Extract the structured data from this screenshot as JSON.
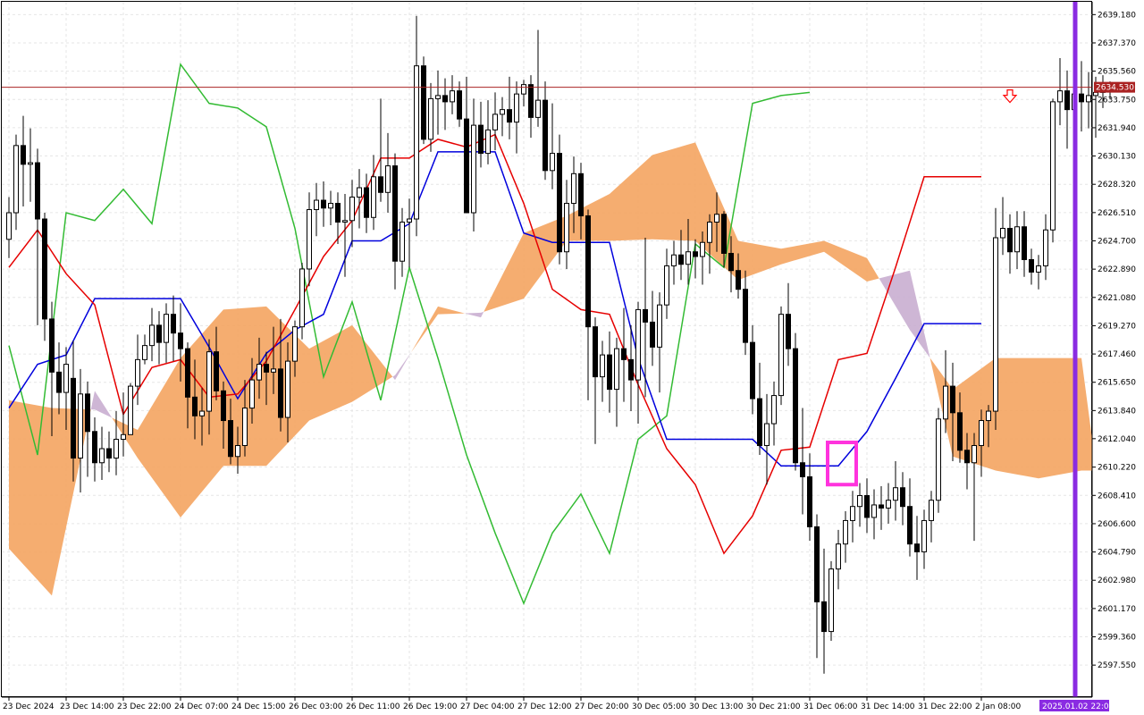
{
  "chart_data": {
    "type": "candlestick",
    "title": "",
    "ylim": [
      2595.5,
      2640.0
    ],
    "grid": true,
    "current_price": "2634.530",
    "current_price_value": 2634.53,
    "cursor_time": "2025.01.02 22:00",
    "y_ticks": [
      "2639.180",
      "2637.370",
      "2635.560",
      "2633.750",
      "2631.940",
      "2630.130",
      "2628.320",
      "2626.510",
      "2624.700",
      "2622.890",
      "2621.080",
      "2619.270",
      "2617.460",
      "2615.650",
      "2613.840",
      "2612.040",
      "2610.220",
      "2608.410",
      "2606.600",
      "2604.790",
      "2602.980",
      "2601.170",
      "2599.360",
      "2597.550"
    ],
    "y_tick_values": [
      2639.18,
      2637.37,
      2635.56,
      2633.75,
      2631.94,
      2630.13,
      2628.32,
      2626.51,
      2624.7,
      2622.89,
      2621.08,
      2619.27,
      2617.46,
      2615.65,
      2613.84,
      2612.04,
      2610.22,
      2608.41,
      2606.6,
      2604.79,
      2602.98,
      2601.17,
      2599.36,
      2597.55
    ],
    "x_ticks": [
      "23 Dec 2024",
      "23 Dec 14:00",
      "23 Dec 22:00",
      "24 Dec 07:00",
      "24 Dec 15:00",
      "26 Dec 03:00",
      "26 Dec 11:00",
      "26 Dec 19:00",
      "27 Dec 04:00",
      "27 Dec 12:00",
      "27 Dec 20:00",
      "30 Dec 05:00",
      "30 Dec 13:00",
      "30 Dec 21:00",
      "31 Dec 06:00",
      "31 Dec 14:00",
      "31 Dec 22:00",
      "2 Jan 08:00"
    ],
    "x_tick_index": [
      0,
      8,
      16,
      24,
      32,
      40,
      48,
      56,
      64,
      72,
      80,
      88,
      96,
      104,
      112,
      120,
      128,
      136
    ],
    "bar_count": 138,
    "colors": {
      "bull": "#000000",
      "bear": "#000000",
      "tenkan": "#e60000",
      "kijun": "#0000dd",
      "chikou": "#33bb33",
      "cloud_up": "#f4a460",
      "cloud_down": "#c9aed0",
      "price_line": "#aa2222",
      "cursor_line": "#8a2be2",
      "highlight": "#ff33dd",
      "arrow": "#ff0000",
      "grid": "#e6e6e6"
    },
    "candles": [
      [
        2624.8,
        2627.5,
        2623.6,
        2626.5
      ],
      [
        2626.5,
        2631.5,
        2625.4,
        2630.8
      ],
      [
        2630.8,
        2632.7,
        2626.9,
        2629.6
      ],
      [
        2629.6,
        2631.9,
        2627.2,
        2629.7
      ],
      [
        2629.7,
        2630.6,
        2619.3,
        2626.1
      ],
      [
        2626.1,
        2626.5,
        2618.3,
        2619.7
      ],
      [
        2619.7,
        2620.8,
        2612.2,
        2616.3
      ],
      [
        2616.3,
        2618.2,
        2613.6,
        2615.0
      ],
      [
        2615.0,
        2617.9,
        2612.6,
        2616.8
      ],
      [
        2615.9,
        2618.3,
        2609.3,
        2610.8
      ],
      [
        2610.8,
        2616.5,
        2608.6,
        2614.9
      ],
      [
        2614.9,
        2615.7,
        2609.6,
        2612.5
      ],
      [
        2612.5,
        2613.4,
        2609.3,
        2610.5
      ],
      [
        2610.5,
        2612.8,
        2609.4,
        2611.4
      ],
      [
        2611.4,
        2612.5,
        2609.9,
        2610.8
      ],
      [
        2610.8,
        2613.8,
        2609.7,
        2612.0
      ],
      [
        2612.0,
        2615.0,
        2610.9,
        2612.3
      ],
      [
        2612.3,
        2615.6,
        2614.2,
        2615.4
      ],
      [
        2615.4,
        2618.7,
        2614.2,
        2617.1
      ],
      [
        2617.1,
        2618.7,
        2616.8,
        2618.0
      ],
      [
        2618.0,
        2620.4,
        2617.0,
        2619.3
      ],
      [
        2619.3,
        2620.2,
        2616.8,
        2618.2
      ],
      [
        2618.2,
        2620.7,
        2616.9,
        2620.0
      ],
      [
        2620.0,
        2621.2,
        2617.0,
        2618.8
      ],
      [
        2618.8,
        2620.7,
        2615.7,
        2617.8
      ],
      [
        2617.8,
        2618.2,
        2612.7,
        2614.7
      ],
      [
        2614.7,
        2617.1,
        2612.0,
        2613.5
      ],
      [
        2613.5,
        2615.3,
        2611.6,
        2613.8
      ],
      [
        2613.8,
        2618.4,
        2612.3,
        2617.6
      ],
      [
        2617.6,
        2619.2,
        2614.5,
        2615.1
      ],
      [
        2615.1,
        2615.7,
        2611.4,
        2613.2
      ],
      [
        2613.2,
        2614.6,
        2610.4,
        2610.9
      ],
      [
        2610.9,
        2612.8,
        2609.8,
        2611.6
      ],
      [
        2611.6,
        2615.8,
        2610.9,
        2614.0
      ],
      [
        2614.0,
        2617.2,
        2613.0,
        2615.8
      ],
      [
        2615.8,
        2618.5,
        2614.6,
        2616.8
      ],
      [
        2616.8,
        2617.6,
        2614.2,
        2616.3
      ],
      [
        2616.3,
        2619.2,
        2614.9,
        2616.5
      ],
      [
        2616.5,
        2619.7,
        2612.5,
        2613.4
      ],
      [
        2613.4,
        2618.2,
        2611.8,
        2617.0
      ],
      [
        2617.0,
        2619.6,
        2616.0,
        2619.2
      ],
      [
        2619.2,
        2623.3,
        2618.4,
        2622.9
      ],
      [
        2622.9,
        2627.8,
        2621.8,
        2626.7
      ],
      [
        2626.7,
        2628.4,
        2625.0,
        2627.3
      ],
      [
        2627.3,
        2628.5,
        2625.6,
        2626.8
      ],
      [
        2626.8,
        2627.9,
        2625.7,
        2627.1
      ],
      [
        2627.1,
        2627.8,
        2624.5,
        2625.9
      ],
      [
        2625.9,
        2627.7,
        2622.4,
        2626.0
      ],
      [
        2626.0,
        2628.6,
        2624.3,
        2627.5
      ],
      [
        2627.5,
        2629.3,
        2625.5,
        2628.1
      ],
      [
        2628.1,
        2629.0,
        2625.2,
        2626.2
      ],
      [
        2626.2,
        2630.2,
        2625.4,
        2628.8
      ],
      [
        2628.8,
        2633.8,
        2627.2,
        2627.8
      ],
      [
        2627.8,
        2631.6,
        2626.5,
        2629.5
      ],
      [
        2629.5,
        2630.3,
        2621.6,
        2623.4
      ],
      [
        2623.4,
        2626.8,
        2622.4,
        2625.9
      ],
      [
        2625.9,
        2627.4,
        2623.0,
        2626.1
      ],
      [
        2626.1,
        2639.1,
        2625.0,
        2635.9
      ],
      [
        2635.9,
        2636.5,
        2630.9,
        2631.2
      ],
      [
        2631.2,
        2634.8,
        2630.4,
        2633.8
      ],
      [
        2633.8,
        2635.6,
        2631.5,
        2634.0
      ],
      [
        2634.0,
        2635.1,
        2631.8,
        2633.6
      ],
      [
        2633.6,
        2635.3,
        2632.8,
        2634.3
      ],
      [
        2634.3,
        2634.9,
        2632.0,
        2632.5
      ],
      [
        2632.5,
        2635.2,
        2628.6,
        2626.5
      ],
      [
        2626.5,
        2633.8,
        2625.3,
        2632.1
      ],
      [
        2632.1,
        2633.6,
        2629.4,
        2630.3
      ],
      [
        2630.3,
        2633.7,
        2629.6,
        2631.8
      ],
      [
        2631.8,
        2634.2,
        2630.5,
        2632.8
      ],
      [
        2632.8,
        2633.9,
        2631.4,
        2633.1
      ],
      [
        2633.1,
        2635.2,
        2631.2,
        2632.3
      ],
      [
        2632.3,
        2634.9,
        2630.3,
        2634.1
      ],
      [
        2634.1,
        2635.0,
        2633.3,
        2634.7
      ],
      [
        2634.7,
        2635.3,
        2631.3,
        2632.6
      ],
      [
        2632.6,
        2638.2,
        2632.0,
        2633.7
      ],
      [
        2633.7,
        2634.9,
        2628.6,
        2629.2
      ],
      [
        2629.2,
        2633.5,
        2628.0,
        2630.3
      ],
      [
        2630.3,
        2631.5,
        2623.2,
        2624.0
      ],
      [
        2624.0,
        2628.6,
        2622.9,
        2627.1
      ],
      [
        2627.1,
        2630.1,
        2625.2,
        2629.0
      ],
      [
        2629.0,
        2629.7,
        2624.8,
        2626.3
      ],
      [
        2626.3,
        2626.7,
        2614.5,
        2619.2
      ],
      [
        2619.2,
        2619.8,
        2611.7,
        2616.0
      ],
      [
        2616.0,
        2618.3,
        2614.4,
        2617.4
      ],
      [
        2617.4,
        2618.9,
        2613.7,
        2615.2
      ],
      [
        2615.2,
        2618.5,
        2612.8,
        2617.8
      ],
      [
        2617.8,
        2620.4,
        2614.4,
        2617.1
      ],
      [
        2617.1,
        2619.3,
        2613.8,
        2615.8
      ],
      [
        2615.8,
        2620.8,
        2613.0,
        2620.3
      ],
      [
        2620.3,
        2624.9,
        2614.7,
        2619.5
      ],
      [
        2619.5,
        2621.5,
        2616.7,
        2617.9
      ],
      [
        2617.9,
        2621.4,
        2615.0,
        2620.6
      ],
      [
        2620.6,
        2624.2,
        2619.7,
        2623.1
      ],
      [
        2623.1,
        2624.7,
        2621.9,
        2623.8
      ],
      [
        2623.8,
        2625.4,
        2622.2,
        2623.2
      ],
      [
        2623.2,
        2626.1,
        2621.9,
        2624.0
      ],
      [
        2624.0,
        2624.8,
        2622.3,
        2623.7
      ],
      [
        2623.7,
        2625.3,
        2621.9,
        2624.6
      ],
      [
        2624.6,
        2626.4,
        2622.6,
        2625.9
      ],
      [
        2625.9,
        2627.8,
        2624.0,
        2626.4
      ],
      [
        2626.4,
        2626.6,
        2623.0,
        2623.9
      ],
      [
        2623.9,
        2625.0,
        2621.4,
        2622.8
      ],
      [
        2622.8,
        2623.9,
        2621.0,
        2621.6
      ],
      [
        2621.6,
        2622.8,
        2617.4,
        2618.2
      ],
      [
        2618.2,
        2619.3,
        2613.6,
        2614.6
      ],
      [
        2614.6,
        2616.9,
        2611.0,
        2611.6
      ],
      [
        2611.6,
        2614.9,
        2609.1,
        2613.0
      ],
      [
        2613.0,
        2615.7,
        2611.6,
        2614.8
      ],
      [
        2614.8,
        2620.5,
        2614.2,
        2620.0
      ],
      [
        2620.0,
        2622.0,
        2616.7,
        2617.8
      ],
      [
        2617.8,
        2618.8,
        2610.0,
        2610.5
      ],
      [
        2610.5,
        2614.0,
        2607.2,
        2609.6
      ],
      [
        2609.6,
        2611.1,
        2605.5,
        2606.4
      ],
      [
        2606.4,
        2607.2,
        2598.0,
        2601.6
      ],
      [
        2601.6,
        2605.0,
        2597.0,
        2599.7
      ],
      [
        2599.7,
        2604.2,
        2599.1,
        2603.7
      ],
      [
        2603.7,
        2606.2,
        2602.4,
        2605.3
      ],
      [
        2605.3,
        2607.4,
        2604.1,
        2606.8
      ],
      [
        2606.8,
        2608.7,
        2605.4,
        2607.7
      ],
      [
        2607.7,
        2609.2,
        2606.4,
        2608.4
      ],
      [
        2608.4,
        2609.5,
        2606.0,
        2607.0
      ],
      [
        2607.0,
        2608.8,
        2605.6,
        2607.8
      ],
      [
        2607.8,
        2609.0,
        2606.2,
        2607.6
      ],
      [
        2607.6,
        2609.2,
        2606.6,
        2608.1
      ],
      [
        2608.1,
        2610.6,
        2606.8,
        2608.9
      ],
      [
        2608.9,
        2609.9,
        2606.5,
        2607.7
      ],
      [
        2607.7,
        2609.5,
        2604.5,
        2605.3
      ],
      [
        2605.3,
        2607.1,
        2603.0,
        2604.8
      ],
      [
        2604.8,
        2607.5,
        2603.7,
        2606.8
      ],
      [
        2606.8,
        2608.7,
        2605.4,
        2608.1
      ],
      [
        2608.1,
        2614.0,
        2607.3,
        2613.3
      ],
      [
        2613.3,
        2617.7,
        2612.4,
        2615.4
      ],
      [
        2615.4,
        2616.9,
        2610.6,
        2613.7
      ],
      [
        2613.7,
        2615.0,
        2610.5,
        2611.3
      ],
      [
        2611.3,
        2612.4,
        2608.8,
        2610.5
      ],
      [
        2610.5,
        2612.4,
        2605.5,
        2611.6
      ],
      [
        2611.6,
        2613.9,
        2609.6,
        2613.2
      ],
      [
        2613.2,
        2614.2,
        2611.5,
        2613.8
      ],
      [
        2613.8,
        2626.8,
        2612.6,
        2624.9
      ],
      [
        2624.9,
        2627.5,
        2623.8,
        2625.5
      ],
      [
        2625.5,
        2626.4,
        2622.6,
        2624.0
      ],
      [
        2624.0,
        2626.6,
        2622.9,
        2625.6
      ],
      [
        2625.6,
        2626.6,
        2622.4,
        2623.5
      ],
      [
        2623.5,
        2624.2,
        2621.9,
        2622.7
      ],
      [
        2622.7,
        2623.8,
        2621.6,
        2623.1
      ],
      [
        2623.1,
        2626.4,
        2622.2,
        2625.4
      ],
      [
        2625.4,
        2633.8,
        2624.6,
        2633.6
      ],
      [
        2633.6,
        2636.4,
        2632.1,
        2634.3
      ],
      [
        2634.3,
        2635.6,
        2630.6,
        2633.1
      ],
      [
        2633.1,
        2635.9,
        2631.6,
        2634.1
      ],
      [
        2634.1,
        2636.2,
        2631.7,
        2633.6
      ],
      [
        2633.6,
        2635.5,
        2631.9,
        2634.0
      ],
      [
        2634.0,
        2635.2,
        2631.3,
        2634.2
      ],
      [
        2634.2,
        2635.3,
        2633.2,
        2634.5
      ],
      [
        2634.5,
        2634.9,
        2633.8,
        2634.5
      ]
    ],
    "tenkan": {
      "x": [
        0,
        4,
        8,
        12,
        16,
        20,
        24,
        28,
        32,
        36,
        40,
        44,
        48,
        52,
        56,
        60,
        64,
        68,
        72,
        76,
        80,
        84,
        88,
        92,
        96,
        100,
        104,
        108,
        112,
        116,
        120,
        124,
        128,
        132,
        136
      ],
      "y": [
        2623.0,
        2625.4,
        2622.6,
        2620.6,
        2613.6,
        2616.6,
        2617.1,
        2614.7,
        2614.9,
        2617.0,
        2620.3,
        2623.7,
        2626.0,
        2630.0,
        2630.0,
        2631.2,
        2630.7,
        2631.5,
        2627.1,
        2621.6,
        2620.3,
        2620.0,
        2615.5,
        2611.4,
        2609.1,
        2604.7,
        2607.1,
        2611.3,
        2611.5,
        2617.1,
        2617.5,
        2623.0,
        2628.8,
        2628.8,
        2628.8
      ]
    },
    "kijun": {
      "x": [
        0,
        4,
        8,
        12,
        16,
        20,
        24,
        28,
        32,
        36,
        40,
        44,
        48,
        52,
        56,
        60,
        64,
        68,
        72,
        76,
        80,
        84,
        88,
        92,
        96,
        100,
        104,
        108,
        112,
        116,
        120,
        124,
        128,
        132,
        136
      ],
      "y": [
        2614.0,
        2616.8,
        2617.4,
        2621.0,
        2621.0,
        2621.0,
        2621.0,
        2617.9,
        2614.6,
        2617.5,
        2619.0,
        2620.0,
        2624.7,
        2624.7,
        2625.8,
        2630.4,
        2630.4,
        2630.4,
        2625.2,
        2624.6,
        2624.6,
        2624.6,
        2617.2,
        2612.0,
        2612.0,
        2612.0,
        2612.0,
        2610.3,
        2610.3,
        2610.3,
        2612.5,
        2615.9,
        2619.4,
        2619.4,
        2619.4
      ]
    },
    "chikou": {
      "x": [
        0,
        4,
        8,
        12,
        16,
        20,
        24,
        28,
        32,
        36,
        40,
        44,
        48,
        52,
        56,
        60,
        64,
        68,
        72,
        76,
        80,
        84,
        88,
        92,
        96,
        100,
        104,
        108,
        112
      ],
      "y": [
        2618.0,
        2611.0,
        2626.5,
        2626.0,
        2628.0,
        2625.8,
        2636.0,
        2633.5,
        2633.2,
        2632.0,
        2625.5,
        2616.0,
        2620.8,
        2614.5,
        2623.0,
        2617.2,
        2611.0,
        2606.0,
        2601.5,
        2606.0,
        2608.5,
        2604.7,
        2612.0,
        2613.5,
        2624.5,
        2623.0,
        2633.5,
        2634.0,
        2634.2
      ]
    },
    "cloud": {
      "x": [
        0,
        6,
        12,
        18,
        24,
        30,
        36,
        42,
        48,
        54,
        60,
        66,
        72,
        78,
        84,
        90,
        96,
        102,
        108,
        114,
        120,
        126,
        132,
        138,
        144,
        150,
        156,
        162,
        168,
        174
      ],
      "span_a": [
        2614.5,
        2614.0,
        2613.9,
        2612.6,
        2617.2,
        2620.3,
        2620.5,
        2617.8,
        2619.3,
        2615.8,
        2620.5,
        2619.8,
        2625.2,
        2626.3,
        2627.7,
        2630.2,
        2631.0,
        2624.7,
        2624.2,
        2624.7,
        2623.6,
        2619.0,
        2615.2,
        2617.2,
        2617.2,
        2617.2,
        2612.0,
        2613.6,
        2614.0,
        2613.4
      ],
      "span_b": [
        2605.0,
        2602.0,
        2615.1,
        2610.8,
        2607.0,
        2610.3,
        2610.3,
        2613.2,
        2614.4,
        2616.1,
        2620.0,
        2620.1,
        2621.0,
        2624.7,
        2624.7,
        2624.8,
        2624.7,
        2622.2,
        2623.2,
        2624.0,
        2622.1,
        2622.8,
        2610.9,
        2610.0,
        2609.5,
        2610.0,
        2610.0,
        2611.0,
        2611.5,
        2612.5
      ]
    },
    "highlight_box": {
      "from_index": 115,
      "to_index": 118,
      "low": 2609.1,
      "high": 2611.8
    },
    "arrow_index": 140
  }
}
